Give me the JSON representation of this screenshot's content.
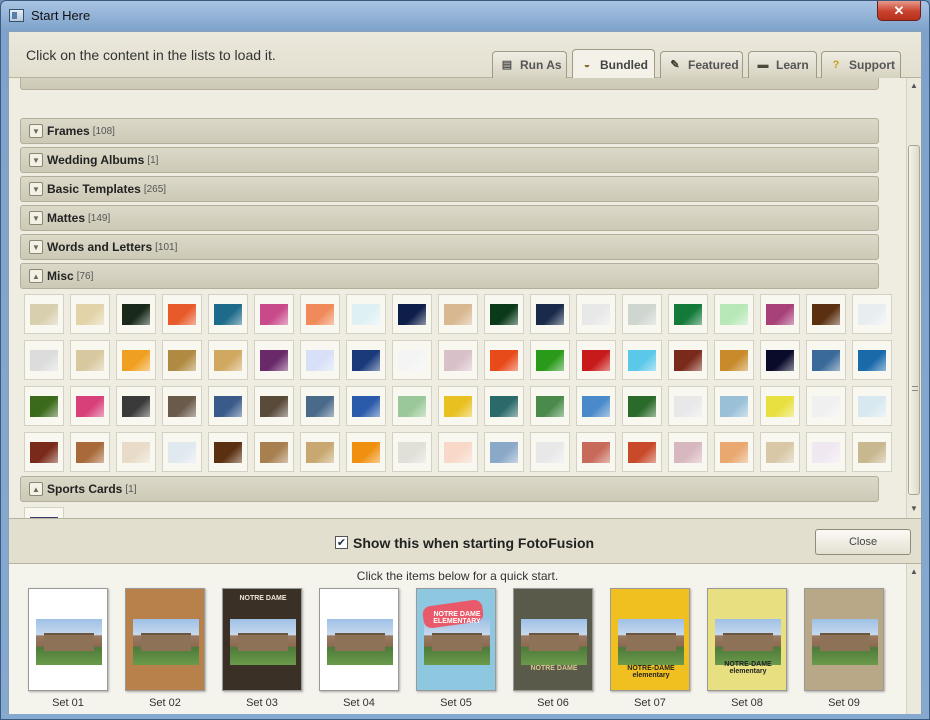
{
  "window": {
    "title": "Start Here",
    "close_glyph": "✕"
  },
  "header": {
    "instruction": "Click on the content in the lists to load it.",
    "tabs": [
      {
        "label": "Run As",
        "icon": "run-as-icon",
        "glyph": "▤"
      },
      {
        "label": "Bundled",
        "icon": "bundled-icon",
        "glyph": "◒"
      },
      {
        "label": "Featured",
        "icon": "featured-icon",
        "glyph": "✎"
      },
      {
        "label": "Learn",
        "icon": "learn-icon",
        "glyph": "▬"
      },
      {
        "label": "Support",
        "icon": "support-icon",
        "glyph": "?"
      }
    ],
    "active_tab": "Bundled"
  },
  "categories": [
    {
      "name": "Frames",
      "count": "[108]",
      "expanded": false
    },
    {
      "name": "Wedding Albums",
      "count": "[1]",
      "expanded": false
    },
    {
      "name": "Basic Templates",
      "count": "[265]",
      "expanded": false
    },
    {
      "name": "Mattes",
      "count": "[149]",
      "expanded": false
    },
    {
      "name": "Words and Letters",
      "count": "[101]",
      "expanded": false
    },
    {
      "name": "Misc",
      "count": "[76]",
      "expanded": true
    },
    {
      "name": "Sports Cards",
      "count": "[1]",
      "expanded": true
    }
  ],
  "collapse_glyph": "▼",
  "expand_glyph": "▲",
  "misc_thumbnails": [
    [
      "#d8cfae",
      "#e2d3a8",
      "#1a2a1a",
      "#e85a2a",
      "#1e6a8a",
      "#c84a8a",
      "#f08a5a",
      "#dff0f4",
      "#0e1e4a",
      "#d8b890",
      "#0a3a1a",
      "#1a2a4a",
      "#e8e8e8",
      "#cfd6d0",
      "#137a3a",
      "#b8e8b8",
      "#a8407a",
      "#5a3010",
      "#e8eef0"
    ],
    [
      "#dcdcdc",
      "#d8c8a0",
      "#f0a020",
      "#b08a40",
      "#d0a860",
      "#6a2a6a",
      "#d8e0f8",
      "#1a3a7a",
      "#f4f4f4",
      "#d8c0c8",
      "#e84a1a",
      "#2a9a1a",
      "#c81a1a",
      "#5ac8e8",
      "#7a2a1a",
      "#c88a2a",
      "#0a0a2a",
      "#3a6a9a",
      "#1a6aaa"
    ],
    [
      "#3a6a1a",
      "#d8407a",
      "#3a3a3a",
      "#6a5a4a",
      "#3a5a8a",
      "#5a4a3a",
      "#4a6a8a",
      "#2a5aaa",
      "#9ac89a",
      "#e8c020",
      "#2a6a6a",
      "#4a8a4a",
      "#4a8aca",
      "#2a6a2a",
      "#e8e8e8",
      "#9ac0d8",
      "#e8e040",
      "#f0f0f0",
      "#d8e8f0"
    ],
    [
      "#7a2a1a",
      "#a86a3a",
      "#e8dcc8",
      "#e0e8f0",
      "#5a3010",
      "#a88050",
      "#c8a870",
      "#f09010",
      "#e0e0d8",
      "#f8d8c8",
      "#8aa8c8",
      "#e8e8e8",
      "#c86a5a",
      "#c84a2a",
      "#d8b8c0",
      "#e8a870",
      "#d8c8a8",
      "#f0e8f0",
      "#c8b890"
    ]
  ],
  "sports_thumbnails": [
    "#3a3a6a"
  ],
  "footer": {
    "checkbox_checked": true,
    "checkbox_glyph": "✔",
    "checkbox_label": "Show this when starting FotoFusion",
    "close_label": "Close"
  },
  "quick_start": {
    "title": "Click the items below for a quick start.",
    "sets": [
      {
        "label": "Set 01"
      },
      {
        "label": "Set 02"
      },
      {
        "label": "Set 03"
      },
      {
        "label": "Set 04"
      },
      {
        "label": "Set 05"
      },
      {
        "label": "Set 06"
      },
      {
        "label": "Set 07"
      },
      {
        "label": "Set 08"
      },
      {
        "label": "Set 09"
      }
    ]
  },
  "cover_text": {
    "set03_title": "NOTRE DAME",
    "set05_title": "NOTRE DAME ELEMENTARY",
    "set06_title": "NOTRE DAME",
    "set07_title": "NOTRE-DAME elementary",
    "set08_title": "NOTRE-DAME elementary"
  }
}
